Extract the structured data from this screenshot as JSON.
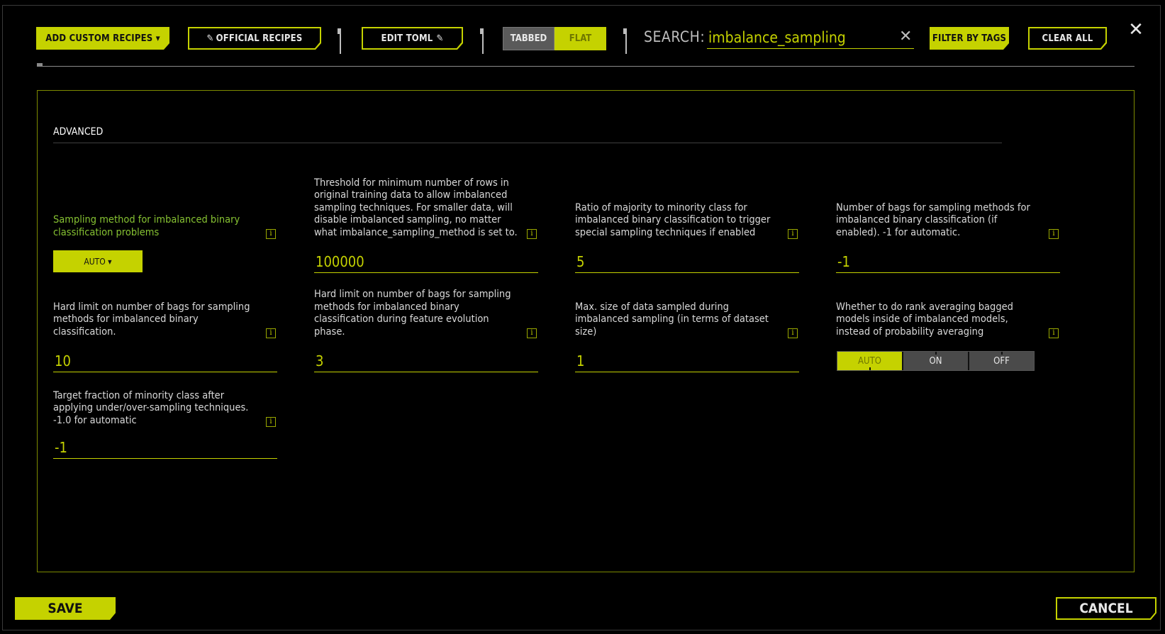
{
  "window": {
    "close_icon": "close-icon"
  },
  "toolbar": {
    "add_custom_recipes": "ADD CUSTOM RECIPES ▾",
    "official_recipes": "OFFICIAL RECIPES",
    "official_recipes_icon": "pencil-icon",
    "edit_toml": "EDIT TOML",
    "edit_toml_icon": "pencil-icon",
    "view_tabbed": "TABBED",
    "view_flat": "FLAT",
    "view_selected": "FLAT",
    "search_label": "SEARCH:",
    "search_value": "imbalance_sampling",
    "filter_by_tags": "FILTER BY TAGS",
    "clear_all": "CLEAR ALL"
  },
  "section": {
    "title": "ADVANCED",
    "fields": [
      {
        "label": "Sampling method for imbalanced binary classification problems",
        "type": "dropdown",
        "value": "AUTO ▾"
      },
      {
        "label": "Threshold for minimum number of rows in original training data to allow imbalanced sampling techniques. For smaller data, will disable imbalanced sampling, no matter what imbalance_sampling_method is set to.",
        "type": "input",
        "value": "100000"
      },
      {
        "label": "Ratio of majority to minority class for imbalanced binary classification to trigger special sampling techniques if enabled",
        "type": "input",
        "value": "5"
      },
      {
        "label": "Number of bags for sampling methods for imbalanced binary classification (if enabled). -1 for automatic.",
        "type": "input",
        "value": "-1"
      },
      {
        "label": "Hard limit on number of bags for sampling methods for imbalanced binary classification.",
        "type": "input",
        "value": "10"
      },
      {
        "label": "Hard limit on number of bags for sampling methods for imbalanced binary classification during feature evolution phase.",
        "type": "input",
        "value": "3"
      },
      {
        "label": "Max. size of data sampled during imbalanced sampling (in terms of dataset size)",
        "type": "input",
        "value": "1"
      },
      {
        "label": "Whether to do rank averaging bagged models inside of imbalanced models, instead of probability averaging",
        "type": "toggle",
        "options": [
          "AUTO",
          "ON",
          "OFF"
        ],
        "selected": "AUTO"
      },
      {
        "label": "Target fraction of minority class after applying under/over-sampling techniques. -1.0 for automatic",
        "type": "input",
        "value": "-1"
      }
    ],
    "info_glyph": "i"
  },
  "footer": {
    "save": "SAVE",
    "cancel": "CANCEL"
  },
  "colors": {
    "accent": "#c5d200",
    "label_green": "#86c232",
    "panel_border": "#7d8a00",
    "background": "#000000"
  }
}
